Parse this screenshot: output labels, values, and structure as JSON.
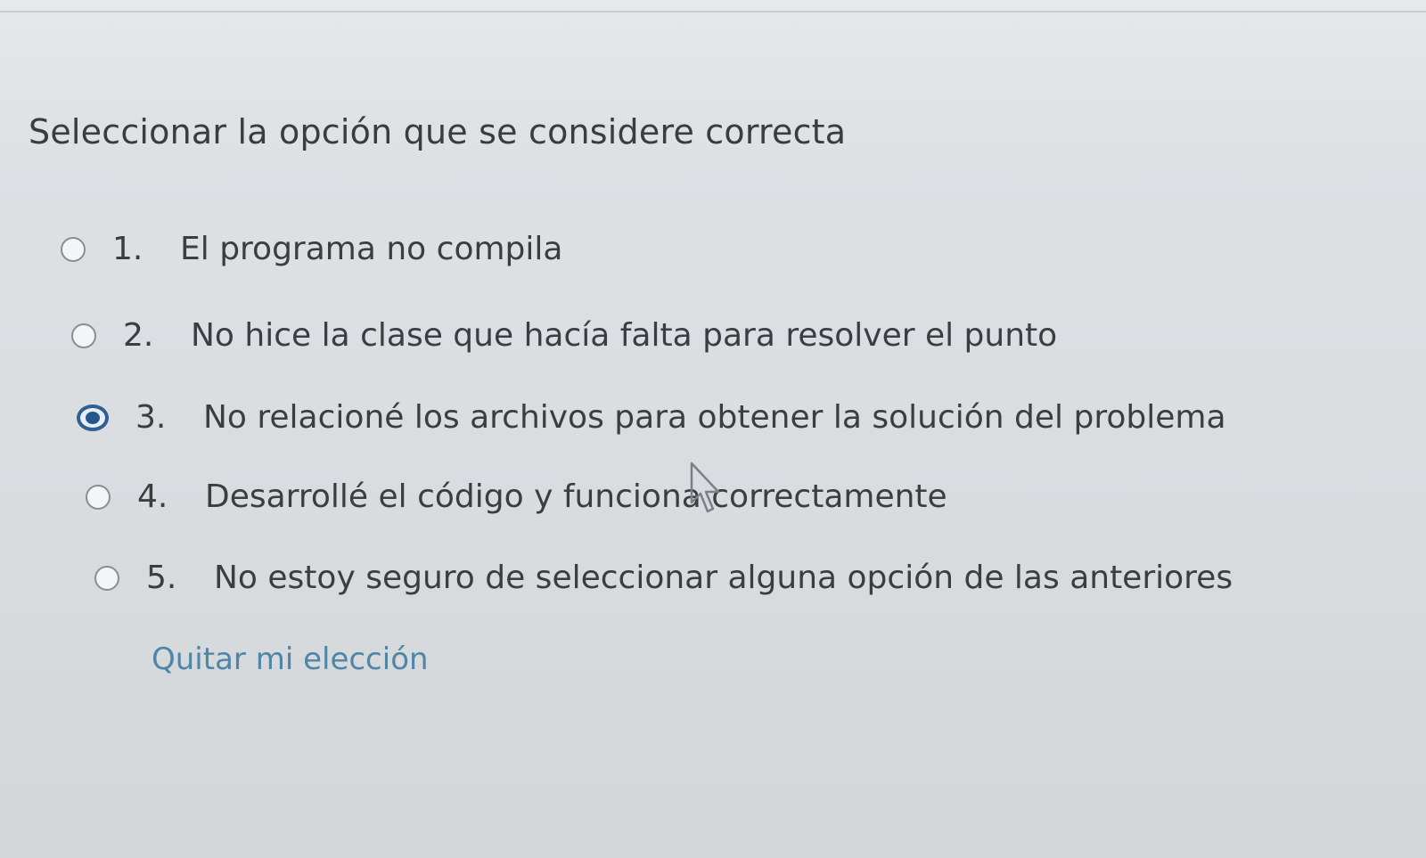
{
  "question": {
    "prompt": "Seleccionar la opción que se considere correcta",
    "options": [
      {
        "number": "1.",
        "label": "El programa no compila",
        "selected": false
      },
      {
        "number": "2.",
        "label": "No hice la clase que hacía falta para resolver el punto",
        "selected": false
      },
      {
        "number": "3.",
        "label": "No relacioné los archivos para obtener la solución del problema",
        "selected": true
      },
      {
        "number": "4.",
        "label": "Desarrollé el código y funciona correctamente",
        "selected": false
      },
      {
        "number": "5.",
        "label": "No estoy seguro de seleccionar alguna opción de las anteriores",
        "selected": false
      }
    ],
    "clear_label": "Quitar mi elección"
  },
  "colors": {
    "accent": "#26578c",
    "link": "#4f86a8"
  },
  "icons": {
    "radio_unchecked": "radio-unchecked-icon",
    "radio_checked": "radio-checked-icon",
    "cursor": "mouse-pointer-icon"
  }
}
